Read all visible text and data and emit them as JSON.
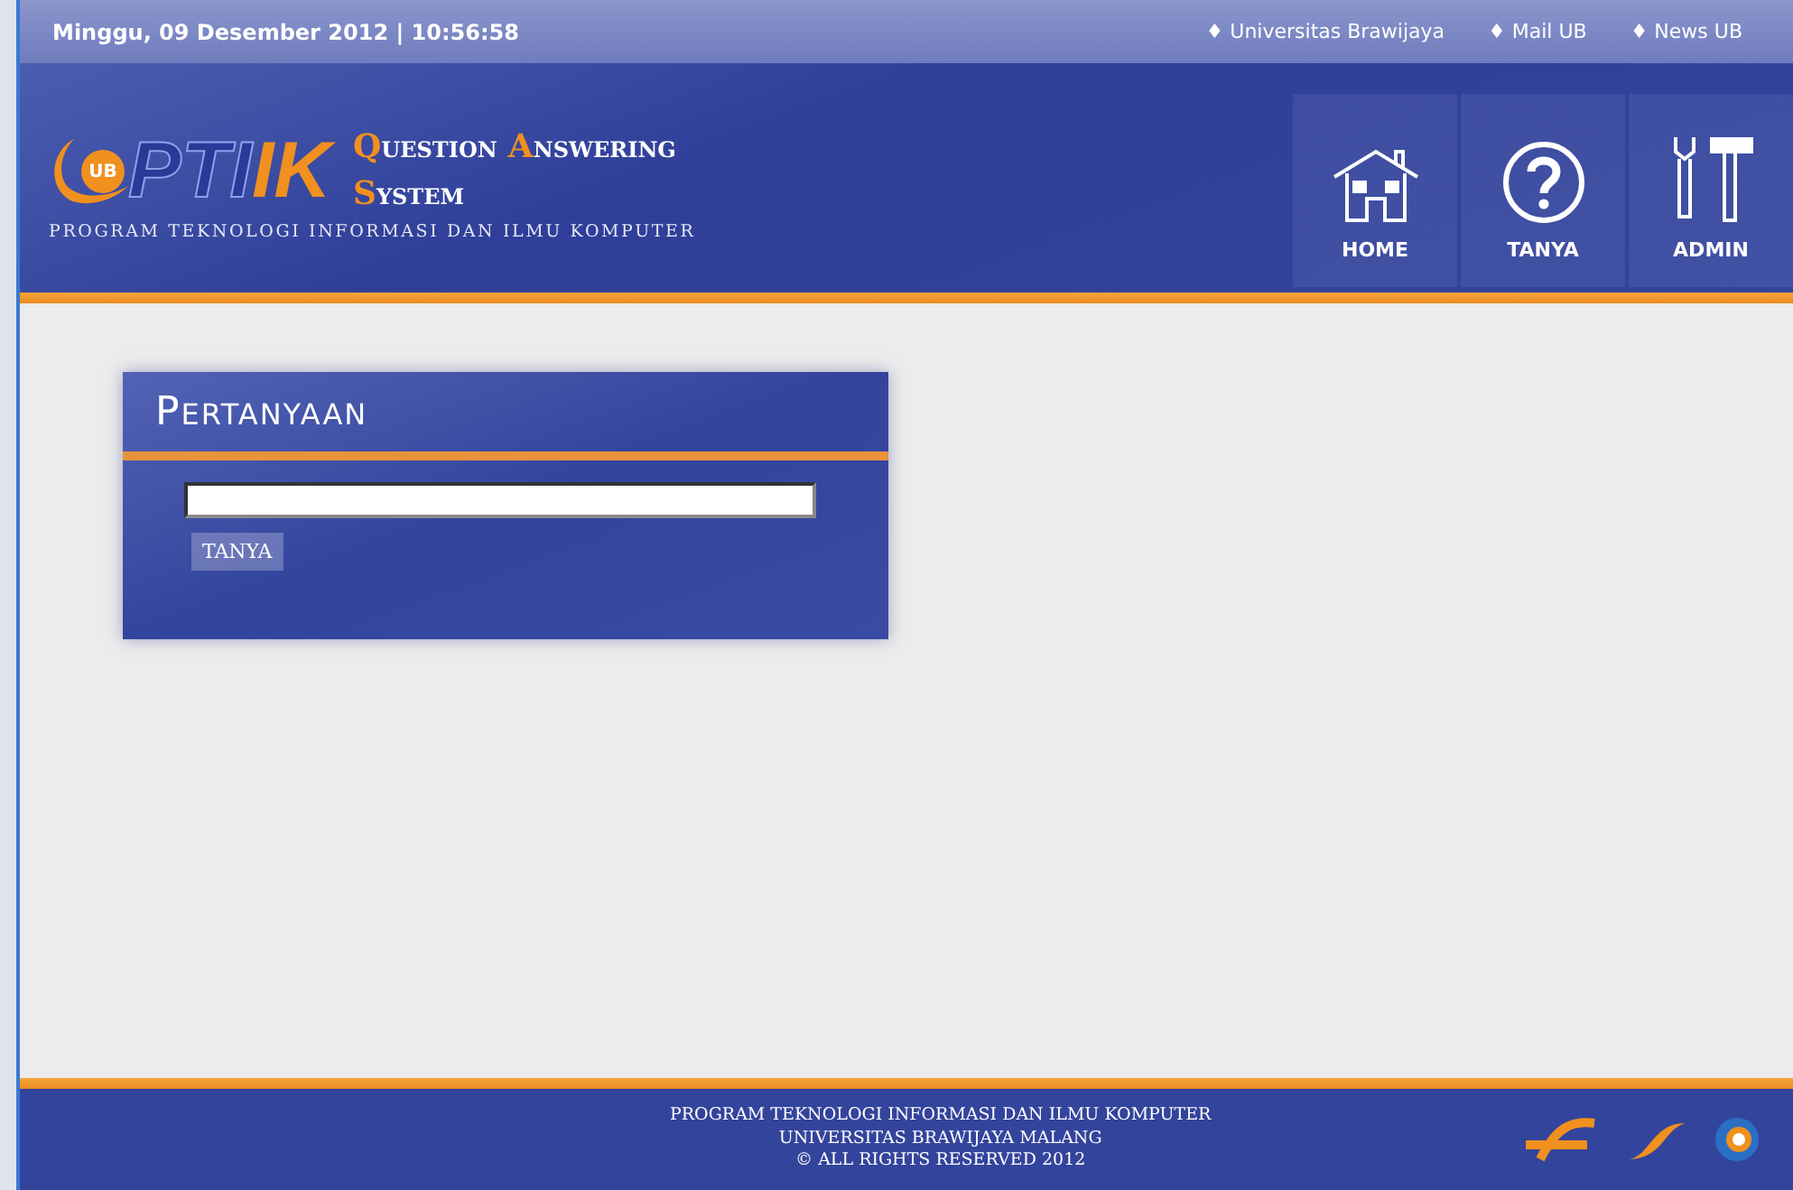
{
  "top_bar": {
    "datetime": "Minggu, 09 Desember 2012 | 10:56:58",
    "links": [
      {
        "bullet": "♦",
        "label": "Universitas Brawijaya"
      },
      {
        "bullet": "♦",
        "label": "Mail UB"
      },
      {
        "bullet": "♦",
        "label": "News UB"
      }
    ]
  },
  "header": {
    "logo_badge": "UB",
    "logo_text": "PTI",
    "logo_accent": "IK",
    "title_lines": [
      [
        "QUESTION",
        "ANSWERING"
      ],
      [
        "SYSTEM"
      ]
    ],
    "subtitle": "PROGRAM TEKNOLOGI INFORMASI DAN ILMU KOMPUTER"
  },
  "nav": [
    {
      "kind": "home",
      "label": "HOME"
    },
    {
      "kind": "question",
      "label": "TANYA"
    },
    {
      "kind": "tools",
      "label": "ADMIN"
    }
  ],
  "panel": {
    "title": "PERTANYAAN",
    "button": "TANYA"
  },
  "footer": {
    "lines": [
      "PROGRAM TEKNOLOGI INFORMASI DAN ILMU KOMPUTER",
      "UNIVERSITAS BRAWIJAYA MALANG",
      "© ALL RIGHTS RESERVED 2012"
    ]
  }
}
